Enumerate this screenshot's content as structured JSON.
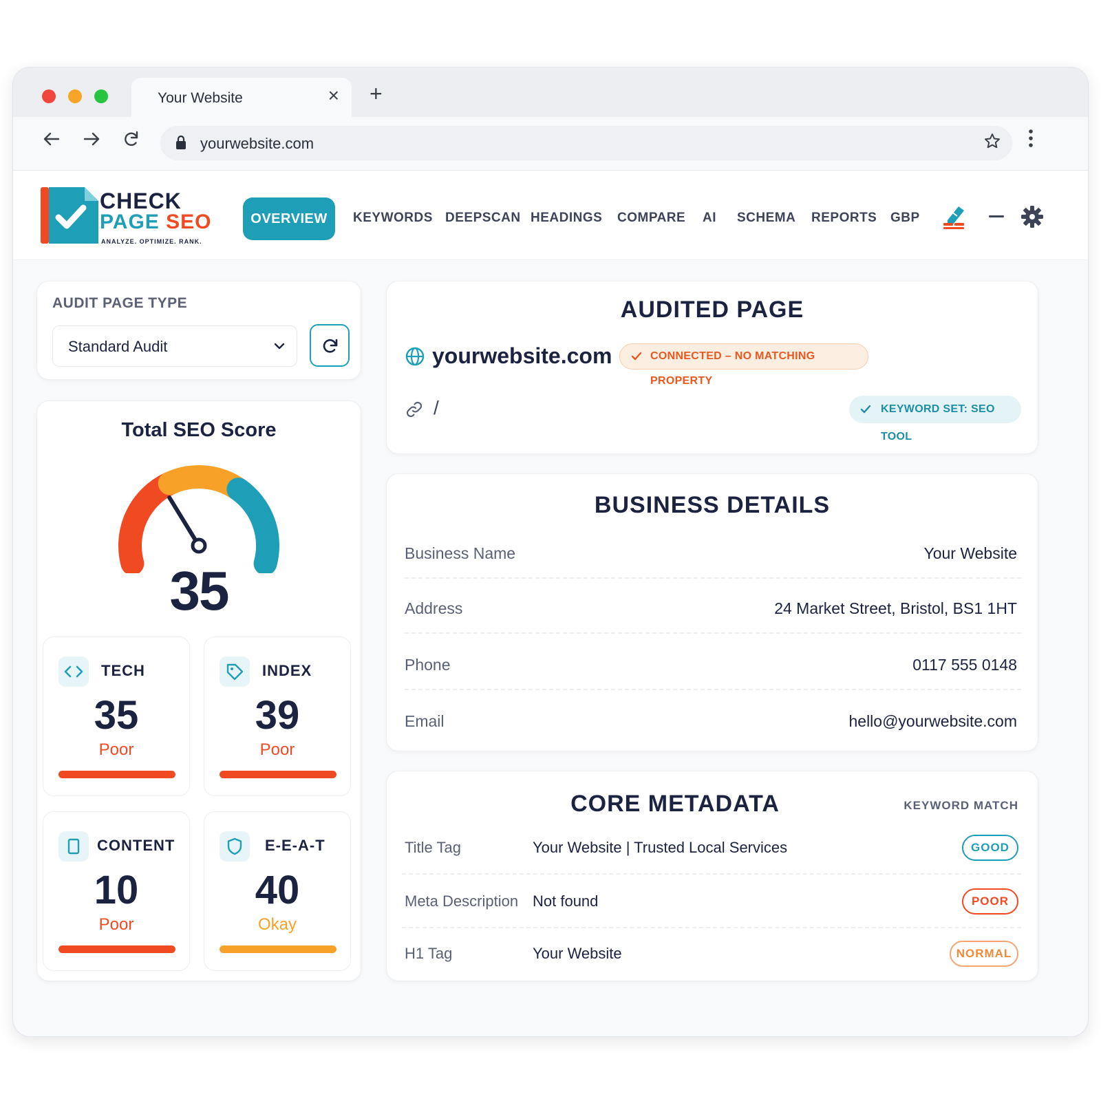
{
  "browser": {
    "tab_title": "Your Website",
    "close_glyph": "×",
    "new_tab_glyph": "+",
    "url": "yourwebsite.com",
    "icons": [
      "back-arrow-icon",
      "forward-arrow-icon",
      "reload-icon",
      "lock-icon",
      "star-icon",
      "more-vert-icon"
    ]
  },
  "brand": {
    "line1": "CHECK",
    "line2_a": "PAGE",
    "line2_b": "SEO",
    "tagline": "ANALYZE. OPTIMIZE. RANK.",
    "colors": {
      "teal": "#1f9fb7",
      "orange": "#f04a23",
      "navy": "#1c2340"
    }
  },
  "nav": {
    "active": "OVERVIEW",
    "items": [
      "KEYWORDS",
      "DEEPSCAN",
      "HEADINGS",
      "COMPARE",
      "AI",
      "SCHEMA",
      "REPORTS",
      "GBP"
    ],
    "icons": [
      "highlighter-icon",
      "minus-icon",
      "gear-icon"
    ]
  },
  "audit": {
    "label": "AUDIT PAGE TYPE",
    "selected": "Standard Audit"
  },
  "score": {
    "title": "Total SEO Score",
    "value": "35",
    "gauge_fraction": 0.35
  },
  "categories": [
    {
      "label": "TECH",
      "value": "35",
      "rating": "Poor",
      "icon": "code-icon",
      "color": "#f04a23"
    },
    {
      "label": "INDEX",
      "value": "39",
      "rating": "Poor",
      "icon": "tag-icon",
      "color": "#f04a23"
    },
    {
      "label": "CONTENT",
      "value": "10",
      "rating": "Poor",
      "icon": "document-icon",
      "color": "#f04a23"
    },
    {
      "label": "E-E-A-T",
      "value": "40",
      "rating": "Okay",
      "icon": "shield-icon",
      "color": "#f7a129"
    }
  ],
  "audited": {
    "title": "AUDITED PAGE",
    "domain": "yourwebsite.com",
    "status": "CONNECTED – NO MATCHING PROPERTY",
    "path": "/",
    "keyword_set": "KEYWORD SET: SEO TOOL"
  },
  "business": {
    "title": "BUSINESS DETAILS",
    "rows": [
      {
        "label": "Business Name",
        "value": "Your Website"
      },
      {
        "label": "Address",
        "value": "24 Market Street, Bristol, BS1 1HT"
      },
      {
        "label": "Phone",
        "value": "0117 555 0148"
      },
      {
        "label": "Email",
        "value": "hello@yourwebsite.com"
      }
    ]
  },
  "metadata": {
    "title": "CORE METADATA",
    "column": "KEYWORD MATCH",
    "rows": [
      {
        "label": "Title Tag",
        "value": "Your Website | Trusted Local Services",
        "badge": "GOOD",
        "color": "#1f9fb7"
      },
      {
        "label": "Meta Description",
        "value": "Not found",
        "badge": "POOR",
        "color": "#f04a23"
      },
      {
        "label": "H1 Tag",
        "value": "Your Website",
        "badge": "NORMAL",
        "color": "#f08a3a"
      }
    ]
  }
}
